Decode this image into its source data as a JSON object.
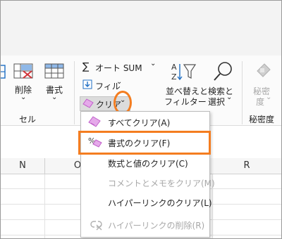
{
  "ribbon": {
    "delete_label": "削除",
    "format_label": "書式",
    "cells_group": "セル",
    "autosum_label": "オート SUM",
    "fill_label": "フィル",
    "clear_label": "クリア",
    "sort_label_1": "並べ替えと",
    "sort_label_2": "フィルター",
    "find_label_1": "検索と",
    "find_label_2": "選択",
    "sensitivity_label_1": "秘密",
    "sensitivity_label_2": "度",
    "sensitivity_group": "秘密度"
  },
  "columns": [
    "N",
    "O",
    "R"
  ],
  "menu": {
    "items": [
      {
        "label": "すべてクリア(A)",
        "enabled": true,
        "icon": "eraser-icon"
      },
      {
        "label": "書式のクリア(F)",
        "enabled": true,
        "icon": "clear-formats-icon"
      },
      {
        "label": "数式と値のクリア(C)",
        "enabled": true,
        "icon": ""
      },
      {
        "label": "コメントとメモをクリア(M)",
        "enabled": false,
        "icon": ""
      },
      {
        "label": "ハイパーリンクのクリア(L)",
        "enabled": true,
        "icon": ""
      },
      {
        "label": "ハイパーリンクの削除(R)",
        "enabled": false,
        "icon": "remove-hyperlink-icon"
      }
    ]
  },
  "colors": {
    "accent_highlight": "#f47d20",
    "eraser_pink": "#c05fc9",
    "blue_icon": "#1f6fc4"
  }
}
